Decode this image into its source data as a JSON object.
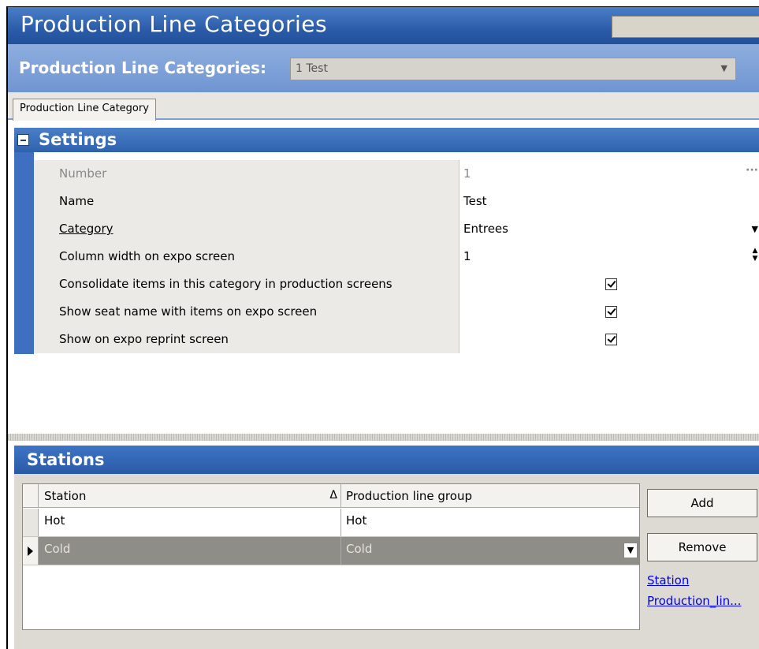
{
  "window": {
    "title": "Production Line Categories"
  },
  "selector": {
    "label": "Production Line Categories:",
    "value": "1 Test"
  },
  "tabs": [
    {
      "label": "Production Line Category"
    }
  ],
  "settings": {
    "header": "Settings",
    "rows": [
      {
        "name": "Number",
        "value": "1"
      },
      {
        "name": "Name",
        "value": "Test"
      },
      {
        "name": "Category",
        "value": "Entrees"
      },
      {
        "name": "Column width on expo screen",
        "value": "1"
      },
      {
        "name": "Consolidate items in this category in production screens",
        "checked": true
      },
      {
        "name": "Show seat name with items on expo screen",
        "checked": true
      },
      {
        "name": "Show on expo reprint screen",
        "checked": true
      }
    ]
  },
  "stations": {
    "header": "Stations",
    "columns": [
      "Station",
      "Production line group"
    ],
    "rows": [
      {
        "station": "Hot",
        "group": "Hot"
      },
      {
        "station": "Cold",
        "group": "Cold"
      }
    ],
    "add_label": "Add",
    "remove_label": "Remove",
    "links": [
      "Station",
      "Production_lin..."
    ]
  },
  "icons": {
    "collapse": "collapse-minus-icon",
    "ellipsis": "ellipsis-icon",
    "dropdown": "dropdown-arrow-icon",
    "spinner": "spinner-icon",
    "sort": "sort-ascending-icon",
    "row_pointer": "row-pointer-icon"
  }
}
